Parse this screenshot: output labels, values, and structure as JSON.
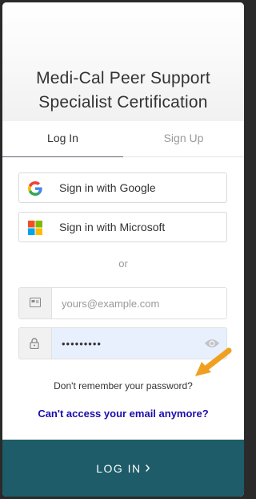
{
  "title_line1": "Medi-Cal Peer Support",
  "title_line2": "Specialist Certification",
  "tabs": {
    "login": "Log In",
    "signup": "Sign Up"
  },
  "social": {
    "google": "Sign in with Google",
    "microsoft": "Sign in with Microsoft"
  },
  "separator": "or",
  "email": {
    "placeholder": "yours@example.com",
    "value": ""
  },
  "password": {
    "value": "•••••••••"
  },
  "links": {
    "forgot": "Don't remember your password?",
    "cant_access": "Can't access your email anymore?"
  },
  "submit": {
    "label": "LOG IN",
    "chevron": "›"
  },
  "colors": {
    "accent": "#1d5c68",
    "link": "#1a0dab",
    "arrow": "#f0a020",
    "autofill": "#e8f0fe"
  },
  "icons": [
    "google-logo",
    "microsoft-logo",
    "envelope-icon",
    "lock-icon",
    "eye-icon",
    "arrow-annotation"
  ]
}
